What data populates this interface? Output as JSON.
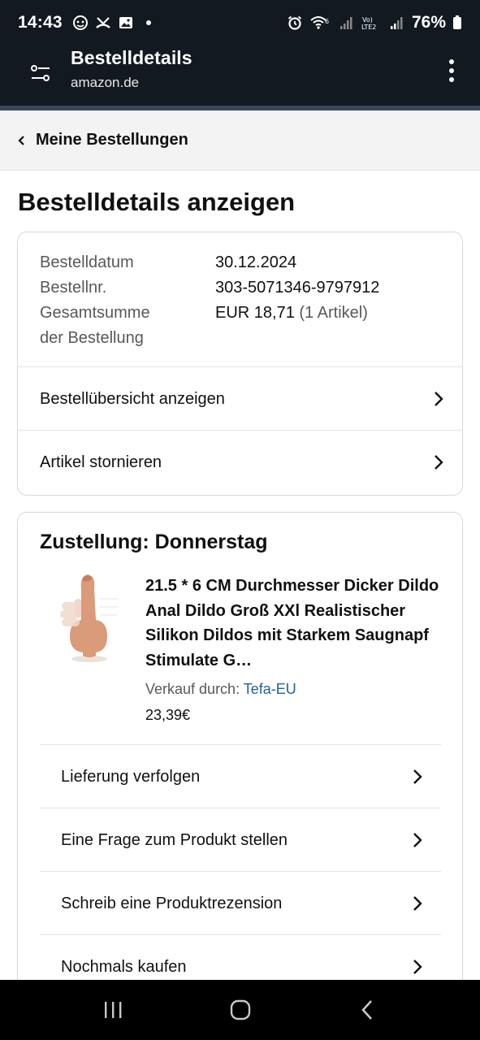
{
  "status_bar": {
    "time": "14:43",
    "battery": "76%"
  },
  "app_bar": {
    "title": "Bestelldetails",
    "subtitle": "amazon.de"
  },
  "breadcrumb": {
    "label": "Meine Bestellungen"
  },
  "page_title": "Bestelldetails anzeigen",
  "order_info": {
    "date_label": "Bestelldatum",
    "date_value": "30.12.2024",
    "number_label": "Bestellnr.",
    "number_value": "303-5071346-9797912",
    "total_label_line1": "Gesamtsumme",
    "total_label_line2": "der Bestellung",
    "total_value": "EUR 18,71",
    "total_items": "(1 Artikel)"
  },
  "order_actions": [
    {
      "label": "Bestellübersicht anzeigen"
    },
    {
      "label": "Artikel stornieren"
    }
  ],
  "delivery": {
    "heading": "Zustellung: Donnerstag",
    "product_title": "21.5 * 6 CM Durchmesser Dicker Dildo Anal Dildo Groß XXl Realistischer Silikon Dildos mit Starkem Saugnapf Stimulate G…",
    "seller_label": "Verkauf durch:",
    "seller_name": "Tefa-EU",
    "price": "23,39€"
  },
  "item_actions": [
    {
      "label": "Lieferung verfolgen"
    },
    {
      "label": "Eine Frage zum Produkt stellen"
    },
    {
      "label": "Schreib eine Produktrezension"
    },
    {
      "label": "Nochmals kaufen"
    }
  ],
  "colors": {
    "header_bg": "#131921",
    "header_line": "#37475a",
    "breadcrumb_bg": "#f3f3f3",
    "link": "#2162a1",
    "muted_text": "#565959"
  },
  "icons": {
    "menu": "filter-settings-icon",
    "more": "more-vertical-icon",
    "back": "chevron-left-icon",
    "row_arrow": "chevron-right-icon",
    "nav_recents": "recents-icon",
    "nav_home": "home-icon",
    "nav_back": "back-icon"
  }
}
